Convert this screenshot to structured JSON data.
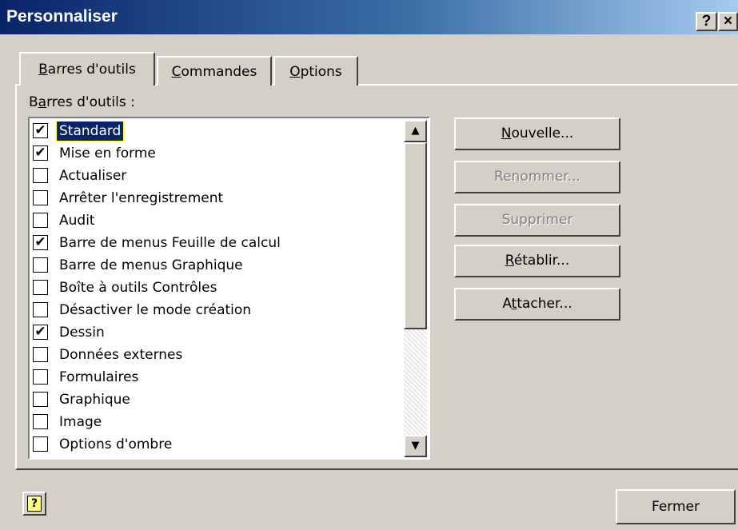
{
  "window": {
    "title": "Personnaliser",
    "help_btn": "?",
    "close_btn": "×"
  },
  "tabs": [
    {
      "label": "Barres d'outils",
      "mnemonic": "B",
      "rest": "arres d'outils",
      "active": true
    },
    {
      "label": "Commandes",
      "mnemonic": "C",
      "rest": "ommandes",
      "active": false
    },
    {
      "label": "Options",
      "mnemonic": "O",
      "rest": "ptions",
      "active": false
    }
  ],
  "list_label": {
    "pre": "B",
    "mnemonic": "a",
    "post": "rres d'outils :"
  },
  "toolbars": [
    {
      "label": "Standard",
      "checked": true,
      "selected": true
    },
    {
      "label": "Mise en forme",
      "checked": true,
      "selected": false
    },
    {
      "label": "Actualiser",
      "checked": false,
      "selected": false
    },
    {
      "label": "Arrêter l'enregistrement",
      "checked": false,
      "selected": false
    },
    {
      "label": "Audit",
      "checked": false,
      "selected": false
    },
    {
      "label": "Barre de menus Feuille de calcul",
      "checked": true,
      "selected": false
    },
    {
      "label": "Barre de menus Graphique",
      "checked": false,
      "selected": false
    },
    {
      "label": "Boîte à outils Contrôles",
      "checked": false,
      "selected": false
    },
    {
      "label": "Désactiver le mode création",
      "checked": false,
      "selected": false
    },
    {
      "label": "Dessin",
      "checked": true,
      "selected": false
    },
    {
      "label": "Données externes",
      "checked": false,
      "selected": false
    },
    {
      "label": "Formulaires",
      "checked": false,
      "selected": false
    },
    {
      "label": "Graphique",
      "checked": false,
      "selected": false
    },
    {
      "label": "Image",
      "checked": false,
      "selected": false
    },
    {
      "label": "Options d'ombre",
      "checked": false,
      "selected": false
    }
  ],
  "scroll": {
    "up_icon": "▲",
    "down_icon": "▼"
  },
  "buttons": {
    "new": {
      "pre": "",
      "mnemonic": "N",
      "post": "ouvelle...",
      "enabled": true
    },
    "rename": {
      "label": "Renommer...",
      "enabled": false
    },
    "delete": {
      "label": "Supprimer",
      "enabled": false
    },
    "reset": {
      "pre": "",
      "mnemonic": "R",
      "post": "établir...",
      "enabled": true
    },
    "attach": {
      "pre": "A",
      "mnemonic": "t",
      "post": "tacher...",
      "enabled": true
    }
  },
  "footer": {
    "help_icon": "?",
    "close_label": "Fermer"
  },
  "colors": {
    "title_start": "#0a246a",
    "title_end": "#a6caf0",
    "selection": "#0a246a",
    "face": "#d4d0c8"
  }
}
